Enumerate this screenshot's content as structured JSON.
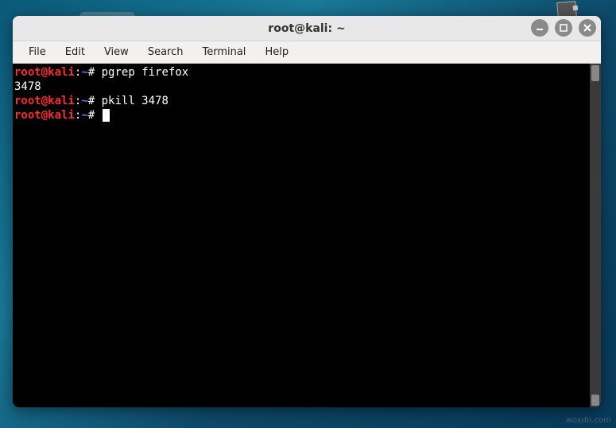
{
  "window": {
    "title": "root@kali: ~"
  },
  "menubar": {
    "items": [
      "File",
      "Edit",
      "View",
      "Search",
      "Terminal",
      "Help"
    ]
  },
  "prompt": {
    "user": "root",
    "at": "@",
    "host": "kali",
    "colon": ":",
    "path": "~",
    "symbol": "#"
  },
  "terminal": {
    "lines": [
      {
        "type": "cmd",
        "text": "pgrep firefox"
      },
      {
        "type": "out",
        "text": "3478"
      },
      {
        "type": "cmd",
        "text": "pkill 3478"
      },
      {
        "type": "cursor",
        "text": ""
      }
    ]
  },
  "controls": {
    "minimize": "minimize",
    "maximize": "maximize",
    "close": "close"
  },
  "watermark": "woxdn.com"
}
